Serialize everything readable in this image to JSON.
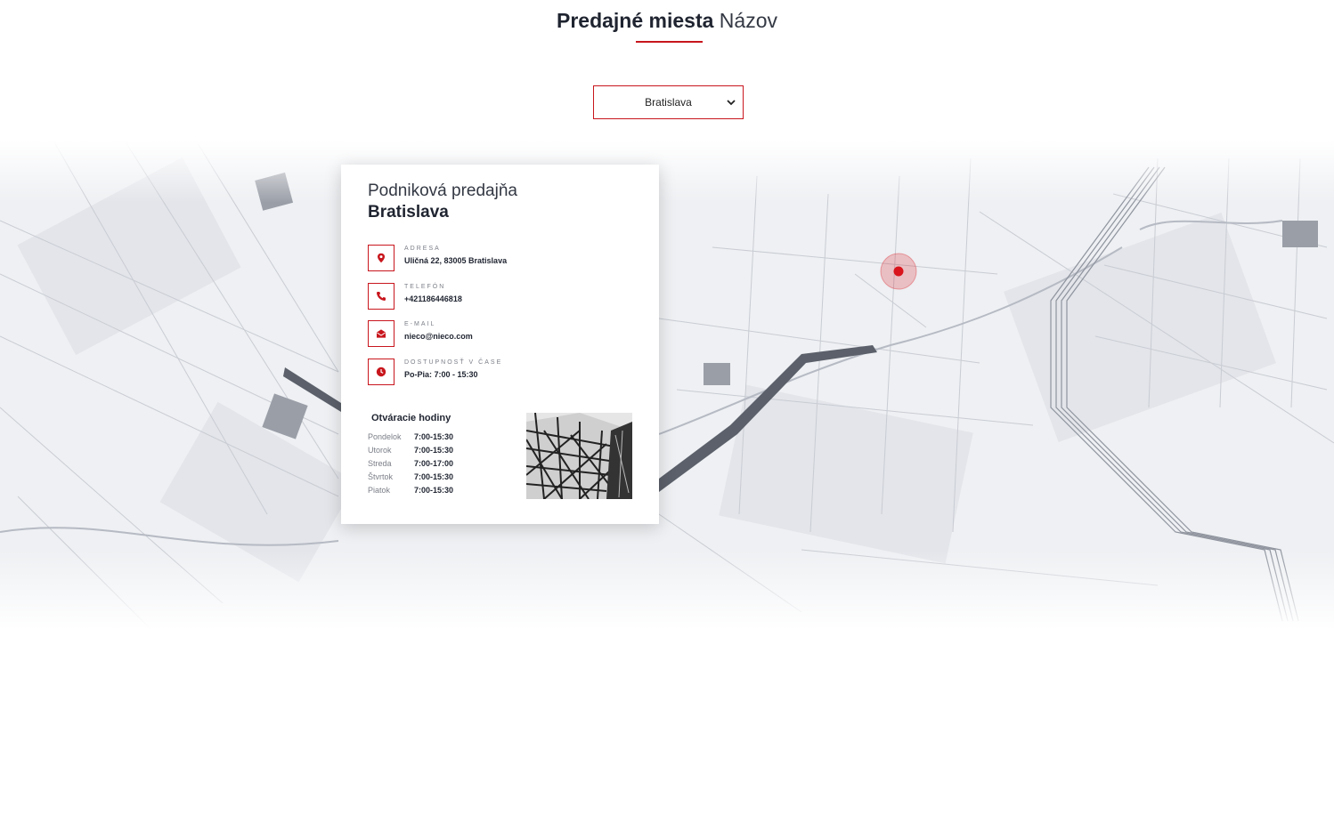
{
  "header": {
    "title_strong": "Predajné miesta",
    "title_light": "Názov"
  },
  "location_select": {
    "selected": "Bratislava"
  },
  "map": {
    "marker_color": "#d9141c"
  },
  "store_card": {
    "title_line1": "Podniková predajňa",
    "title_line2": "Bratislava",
    "info": [
      {
        "icon": "map-pin-icon",
        "label": "ADRESA",
        "value": "Uličná 22, 83005 Bratislava"
      },
      {
        "icon": "phone-icon",
        "label": "TELEFÓN",
        "value": "+421186446818"
      },
      {
        "icon": "envelope-icon",
        "label": "E-MAIL",
        "value": "nieco@nieco.com"
      },
      {
        "icon": "clock-icon",
        "label": "DOSTUPNOSŤ V ČASE",
        "value": "Po-Pia: 7:00 - 15:30"
      }
    ],
    "hours_title": "Otváracie hodiny",
    "hours": [
      {
        "day": "Pondelok",
        "time": "7:00-15:30"
      },
      {
        "day": "Utorok",
        "time": "7:00-15:30"
      },
      {
        "day": "Streda",
        "time": "7:00-17:00"
      },
      {
        "day": "Štvrtok",
        "time": "7:00-15:30"
      },
      {
        "day": "Piatok",
        "time": "7:00-15:30"
      }
    ]
  },
  "colors": {
    "accent": "#c8161d",
    "text_dark": "#1f2430"
  }
}
